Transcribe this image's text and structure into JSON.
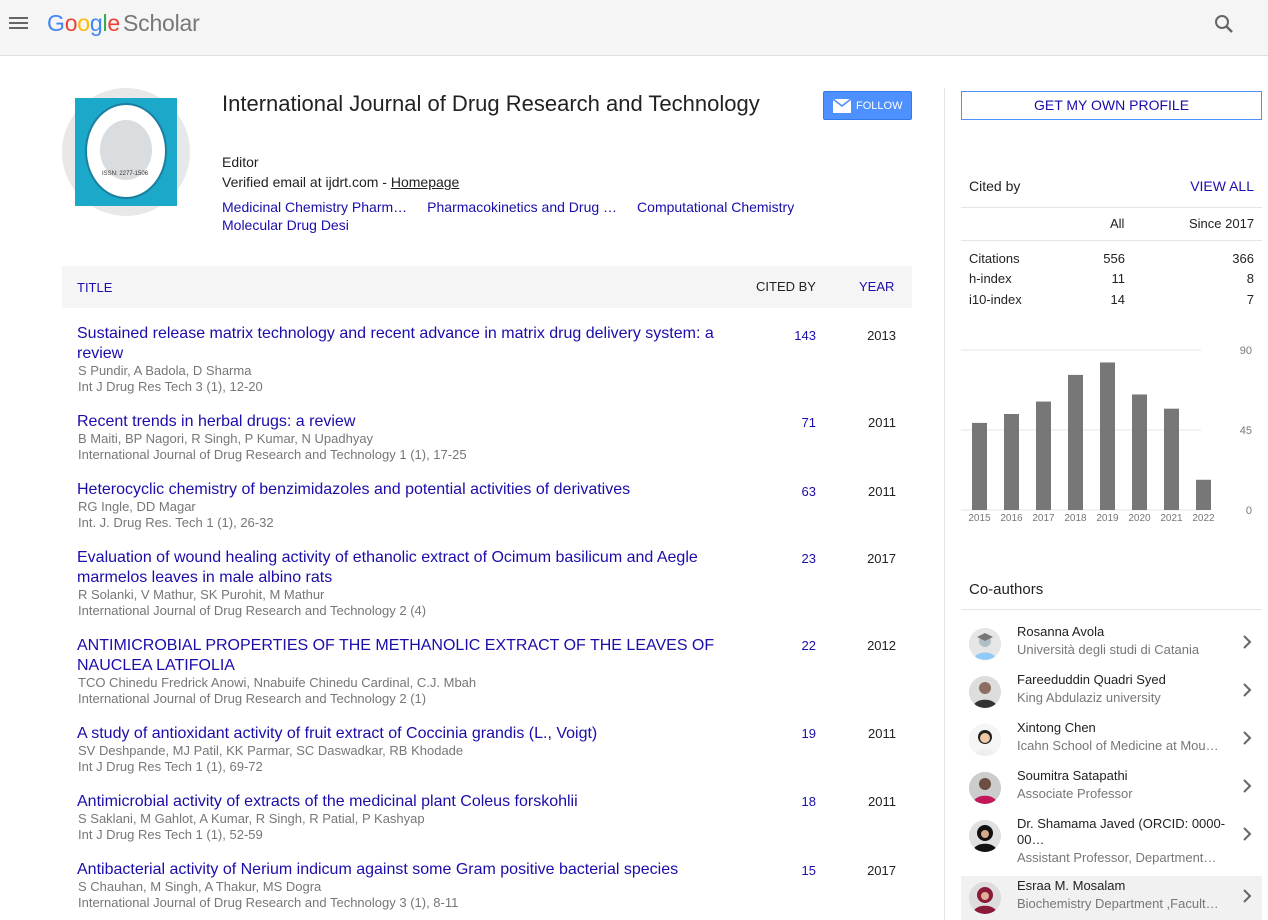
{
  "header": {
    "logo_letters": [
      "G",
      "o",
      "o",
      "g",
      "l",
      "e"
    ],
    "logo_suffix": "Scholar",
    "menu_icon": "hamburger-menu-icon",
    "search_icon": "search-icon"
  },
  "profile": {
    "name": "International Journal of Drug Research and Technology",
    "affiliation": "Editor",
    "email_text": "Verified email at ijdrt.com - ",
    "homepage_label": "Homepage",
    "follow_label": "FOLLOW",
    "avatar_issn": "ISSN: 2277-1506",
    "interests": [
      "Medicinal Chemistry Pharm…",
      "Pharmacokinetics and Drug …",
      "Computational Chemistry",
      "Molecular Drug Desi"
    ]
  },
  "table": {
    "col_title": "TITLE",
    "col_cited": "CITED BY",
    "col_year": "YEAR",
    "rows": [
      {
        "title": "Sustained release matrix technology and recent advance in matrix drug delivery system: a review",
        "authors": "S Pundir, A Badola, D Sharma",
        "venue": "Int J Drug Res Tech 3 (1), 12-20",
        "cited": "143",
        "year": "2013"
      },
      {
        "title": "Recent trends in herbal drugs: a review",
        "authors": "B Maiti, BP Nagori, R Singh, P Kumar, N Upadhyay",
        "venue": "International Journal of Drug Research and Technology 1 (1), 17-25",
        "cited": "71",
        "year": "2011"
      },
      {
        "title": "Heterocyclic chemistry of benzimidazoles and potential activities of derivatives",
        "authors": "RG Ingle, DD Magar",
        "venue": "Int. J. Drug Res. Tech 1 (1), 26-32",
        "cited": "63",
        "year": "2011"
      },
      {
        "title": "Evaluation of wound healing activity of ethanolic extract of Ocimum basilicum and Aegle marmelos leaves in male albino rats",
        "authors": "R Solanki, V Mathur, SK Purohit, M Mathur",
        "venue": "International Journal of Drug Research and Technology 2 (4)",
        "cited": "23",
        "year": "2017"
      },
      {
        "title": "ANTIMICROBIAL PROPERTIES OF THE METHANOLIC EXTRACT OF THE LEAVES OF NAUCLEA LATIFOLIA",
        "authors": "TCO Chinedu Fredrick Anowi, Nnabuife Chinedu Cardinal, C.J. Mbah",
        "venue": "International Journal of Drug Research and Technology 2 (1)",
        "cited": "22",
        "year": "2012"
      },
      {
        "title": "A study of antioxidant activity of fruit extract of Coccinia grandis (L., Voigt)",
        "authors": "SV Deshpande, MJ Patil, KK Parmar, SC Daswadkar, RB Khodade",
        "venue": "Int J Drug Res Tech 1 (1), 69-72",
        "cited": "19",
        "year": "2011"
      },
      {
        "title": "Antimicrobial activity of extracts of the medicinal plant Coleus forskohlii",
        "authors": "S Saklani, M Gahlot, A Kumar, R Singh, R Patial, P Kashyap",
        "venue": "Int J Drug Res Tech 1 (1), 52-59",
        "cited": "18",
        "year": "2011"
      },
      {
        "title": "Antibacterial activity of Nerium indicum against some Gram positive bacterial species",
        "authors": "S Chauhan, M Singh, A Thakur, MS Dogra",
        "venue": "International Journal of Drug Research and Technology 3 (1), 8-11",
        "cited": "15",
        "year": "2017"
      }
    ]
  },
  "sidebar": {
    "get_profile_label": "GET MY OWN PROFILE",
    "cited_by_title": "Cited by",
    "view_all_label": "VIEW ALL",
    "col_all": "All",
    "col_since": "Since 2017",
    "stats": [
      {
        "label": "Citations",
        "all": "556",
        "since": "366"
      },
      {
        "label": "h-index",
        "all": "11",
        "since": "8"
      },
      {
        "label": "i10-index",
        "all": "14",
        "since": "7"
      }
    ],
    "coauthors_title": "Co-authors",
    "coauthors": [
      {
        "name": "Rosanna Avola",
        "affiliation": "Università degli studi di Catania",
        "avatar": "default-avatar"
      },
      {
        "name": "Fareeduddin Quadri Syed",
        "affiliation": "King Abdulaziz university",
        "avatar": "photo"
      },
      {
        "name": "Xintong Chen",
        "affiliation": "Icahn School of Medicine at Mou…",
        "avatar": "photo"
      },
      {
        "name": "Soumitra Satapathi",
        "affiliation": "Associate Professor",
        "avatar": "photo"
      },
      {
        "name": "Dr. Shamama Javed (ORCID: 0000-00…",
        "affiliation": "Assistant Professor, Department…",
        "avatar": "photo"
      },
      {
        "name": "Esraa M. Mosalam",
        "affiliation": "Biochemistry Department ,Facult…",
        "avatar": "photo"
      }
    ]
  },
  "chart_data": {
    "type": "bar",
    "categories": [
      "2015",
      "2016",
      "2017",
      "2018",
      "2019",
      "2020",
      "2021",
      "2022"
    ],
    "values": [
      49,
      54,
      61,
      76,
      83,
      65,
      57,
      17
    ],
    "y_ticks": [
      "90",
      "45",
      "0"
    ],
    "ylim": [
      0,
      90
    ],
    "bar_color": "#777777",
    "grid": true
  },
  "colors": {
    "link": "#1a0dab",
    "follow_bg": "#4d90fe",
    "meta_text": "#777777"
  }
}
